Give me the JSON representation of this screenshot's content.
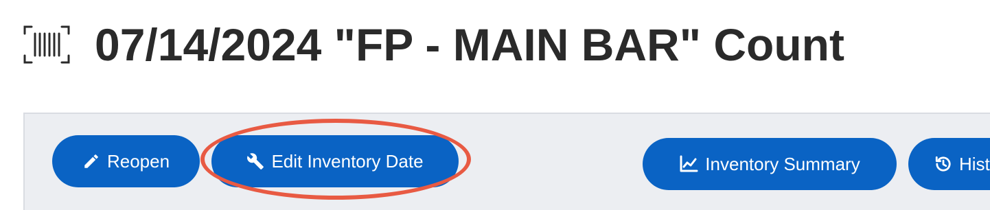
{
  "page": {
    "title": "07/14/2024 \"FP - MAIN BAR\" Count",
    "title_icon": "barcode-scan-icon"
  },
  "toolbar": {
    "reopen_label": "Reopen",
    "reopen_icon": "pencil-icon",
    "edit_date_label": "Edit Inventory Date",
    "edit_date_icon": "wrench-icon",
    "summary_label": "Inventory Summary",
    "summary_icon": "line-chart-icon",
    "history_label": "Hist",
    "history_icon": "history-icon"
  },
  "colors": {
    "button_bg": "#0a63c4",
    "toolbar_bg": "#eceef2",
    "annotation": "#e85a43",
    "title_text": "#2a2a2a"
  },
  "annotation": {
    "highlighted": "Edit Inventory Date"
  }
}
